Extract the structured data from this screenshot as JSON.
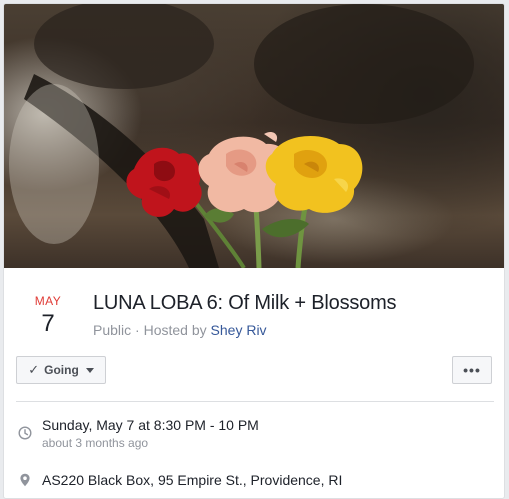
{
  "event": {
    "month": "MAY",
    "day": "7",
    "title": "LUNA LOBA 6: Of Milk + Blossoms",
    "privacy": "Public",
    "hosted_by_prefix": "Hosted by",
    "host_name": "Shey Riv"
  },
  "actions": {
    "going_label": "Going",
    "more_label": "•••"
  },
  "details": {
    "datetime": "Sunday, May 7 at 8:30 PM - 10 PM",
    "relative_time": "about 3 months ago",
    "location": "AS220 Black Box, 95 Empire St., Providence, RI"
  },
  "icons": {
    "time": "clock-icon",
    "location": "map-pin-icon",
    "going": "checkmark-icon",
    "dropdown": "caret-down-icon"
  },
  "colors": {
    "month_red": "#e03b36",
    "link_blue": "#365899",
    "muted_gray": "#90949c"
  },
  "cover": {
    "subject": "red, pink and yellow roses held up in front of a dark background"
  }
}
